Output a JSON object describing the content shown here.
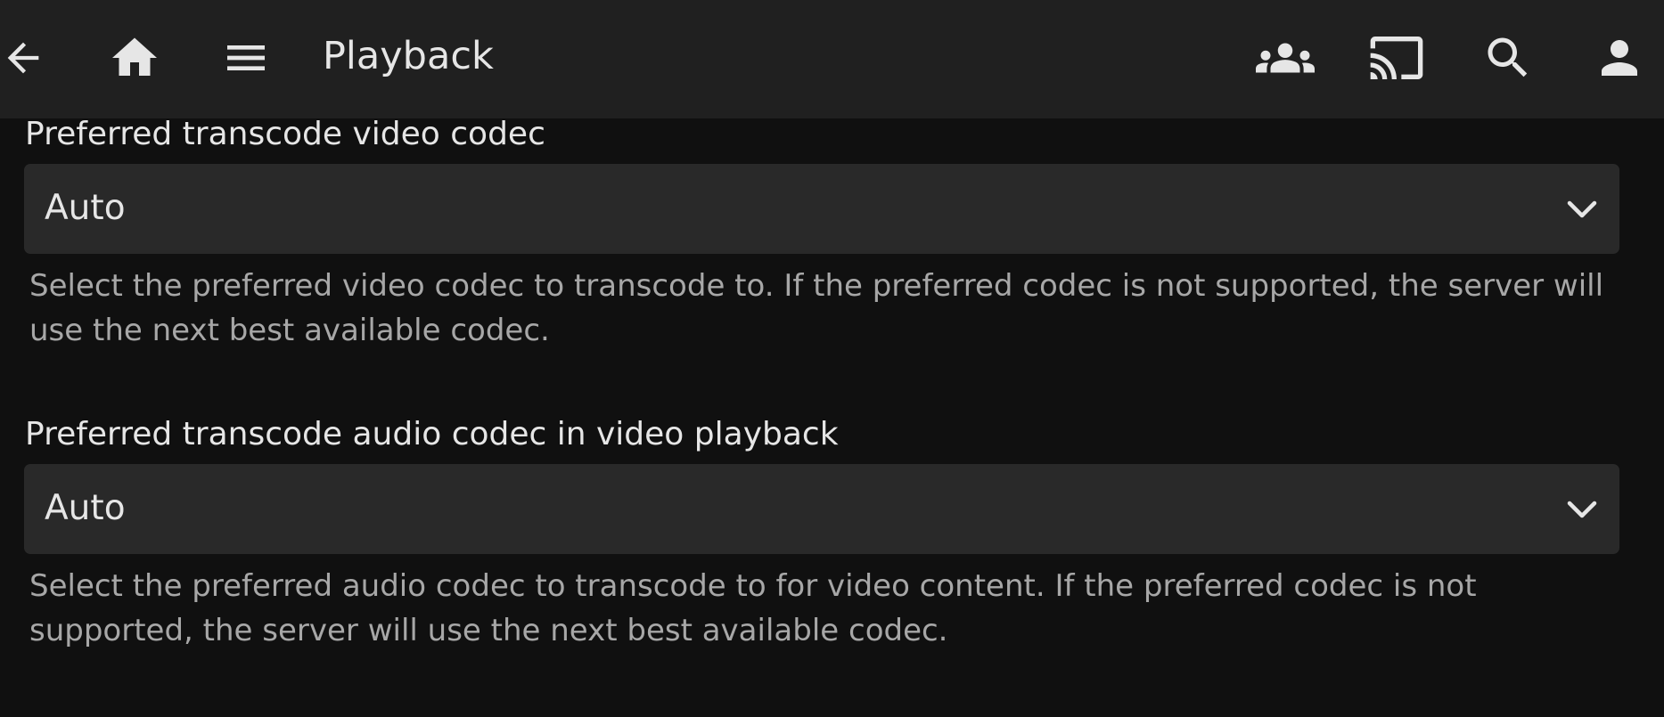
{
  "header": {
    "title": "Playback",
    "left_icons": [
      "arrow-back-icon",
      "home-icon",
      "menu-icon"
    ],
    "right_icons": [
      "group-icon",
      "cast-icon",
      "search-icon",
      "user-icon"
    ]
  },
  "settings": [
    {
      "label": "Preferred transcode video codec",
      "value": "Auto",
      "description": "Select the preferred video codec to transcode to. If the preferred codec is not supported, the server will use the next best available codec."
    },
    {
      "label": "Preferred transcode audio codec in video playback",
      "value": "Auto",
      "description": "Select the preferred audio codec to transcode to for video content. If the preferred codec is not supported, the server will use the next best available codec."
    }
  ],
  "colors": {
    "background": "#101010",
    "header": "#202020",
    "select_background": "#292929",
    "text": "#e6e6e6",
    "description_text": "#a7a7a7"
  }
}
